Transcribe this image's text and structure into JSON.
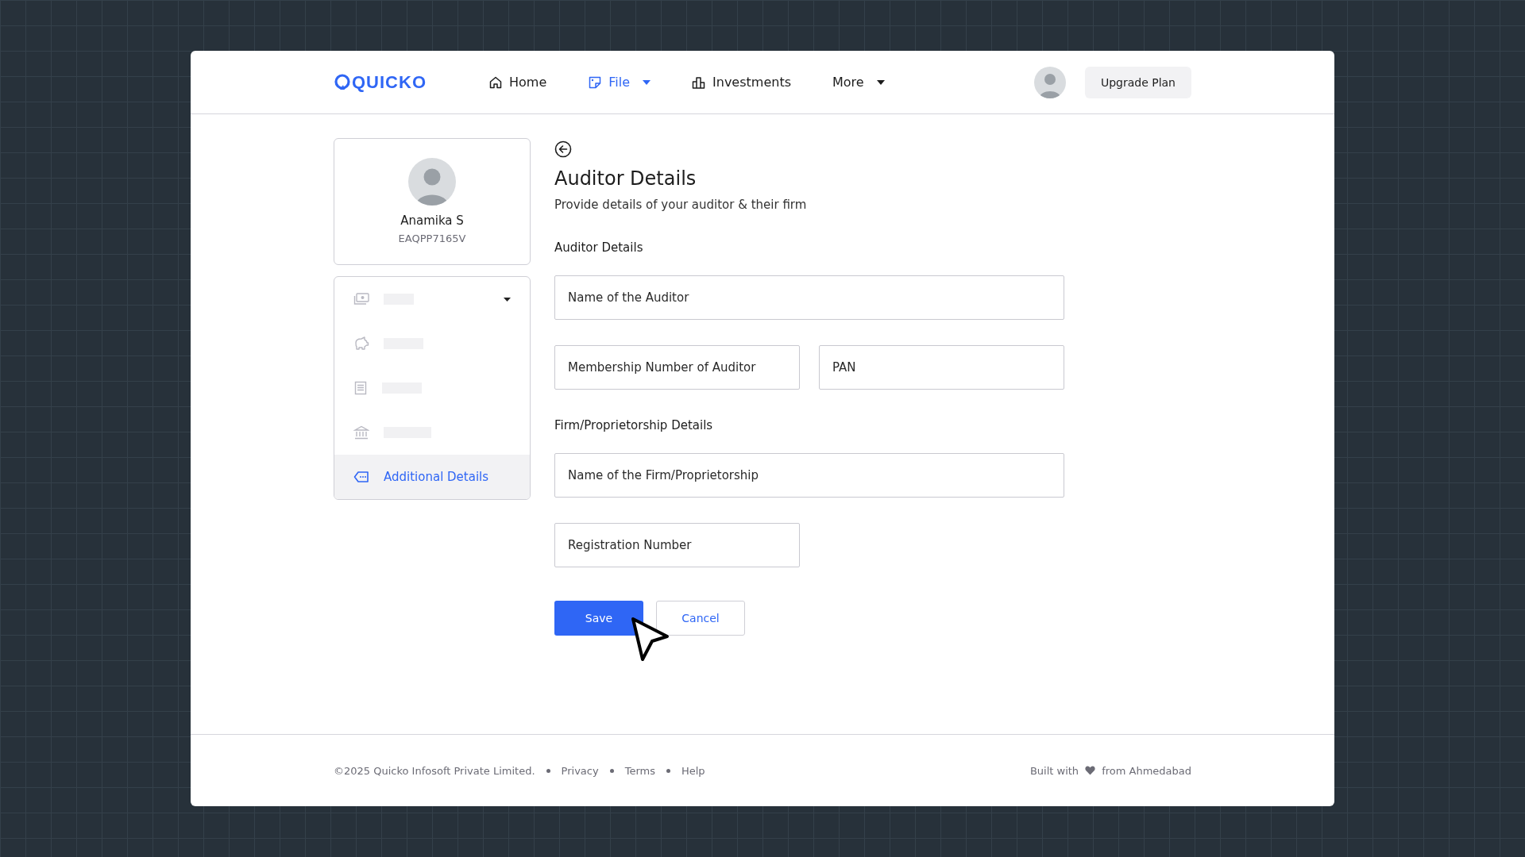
{
  "header": {
    "logo": "QUICKO",
    "nav": [
      {
        "label": "Home",
        "kind": "link",
        "selected": false
      },
      {
        "label": "File",
        "kind": "menu",
        "selected": true
      },
      {
        "label": "Investments",
        "kind": "link",
        "selected": false
      },
      {
        "label": "More",
        "kind": "menu",
        "selected": false
      }
    ],
    "upgrade_button": "Upgrade Plan"
  },
  "profile": {
    "name": "Anamika S",
    "pan": "EAQPP7165V"
  },
  "sidebar": {
    "items": [
      {
        "kind": "skeleton",
        "selected": false,
        "expandable": true
      },
      {
        "kind": "skeleton",
        "selected": false,
        "expandable": false
      },
      {
        "kind": "skeleton",
        "selected": false,
        "expandable": false
      },
      {
        "kind": "skeleton",
        "selected": false,
        "expandable": false
      },
      {
        "kind": "text",
        "label": "Additional Details",
        "selected": true,
        "expandable": false
      }
    ]
  },
  "page": {
    "title": "Auditor Details",
    "subtitle": "Provide details of your auditor & their firm",
    "sections": [
      {
        "heading": "Auditor Details",
        "rows": [
          [
            {
              "placeholder": "Name of the Auditor"
            }
          ],
          [
            {
              "placeholder": "Membership Number of Auditor"
            },
            {
              "placeholder": "PAN"
            }
          ]
        ]
      },
      {
        "heading": "Firm/Proprietorship Details",
        "rows": [
          [
            {
              "placeholder": "Name of the Firm/Proprietorship"
            }
          ],
          [
            {
              "placeholder": "Registration Number"
            }
          ]
        ]
      }
    ],
    "buttons": [
      {
        "label": "Save",
        "kind": "primary"
      },
      {
        "label": "Cancel",
        "kind": "secondary"
      }
    ]
  },
  "footer": {
    "copyright": "©2025 Quicko Infosoft Private Limited.",
    "links": [
      "Privacy",
      "Terms",
      "Help"
    ],
    "built_with": "Built with",
    "built_from": "from Ahmedabad"
  }
}
